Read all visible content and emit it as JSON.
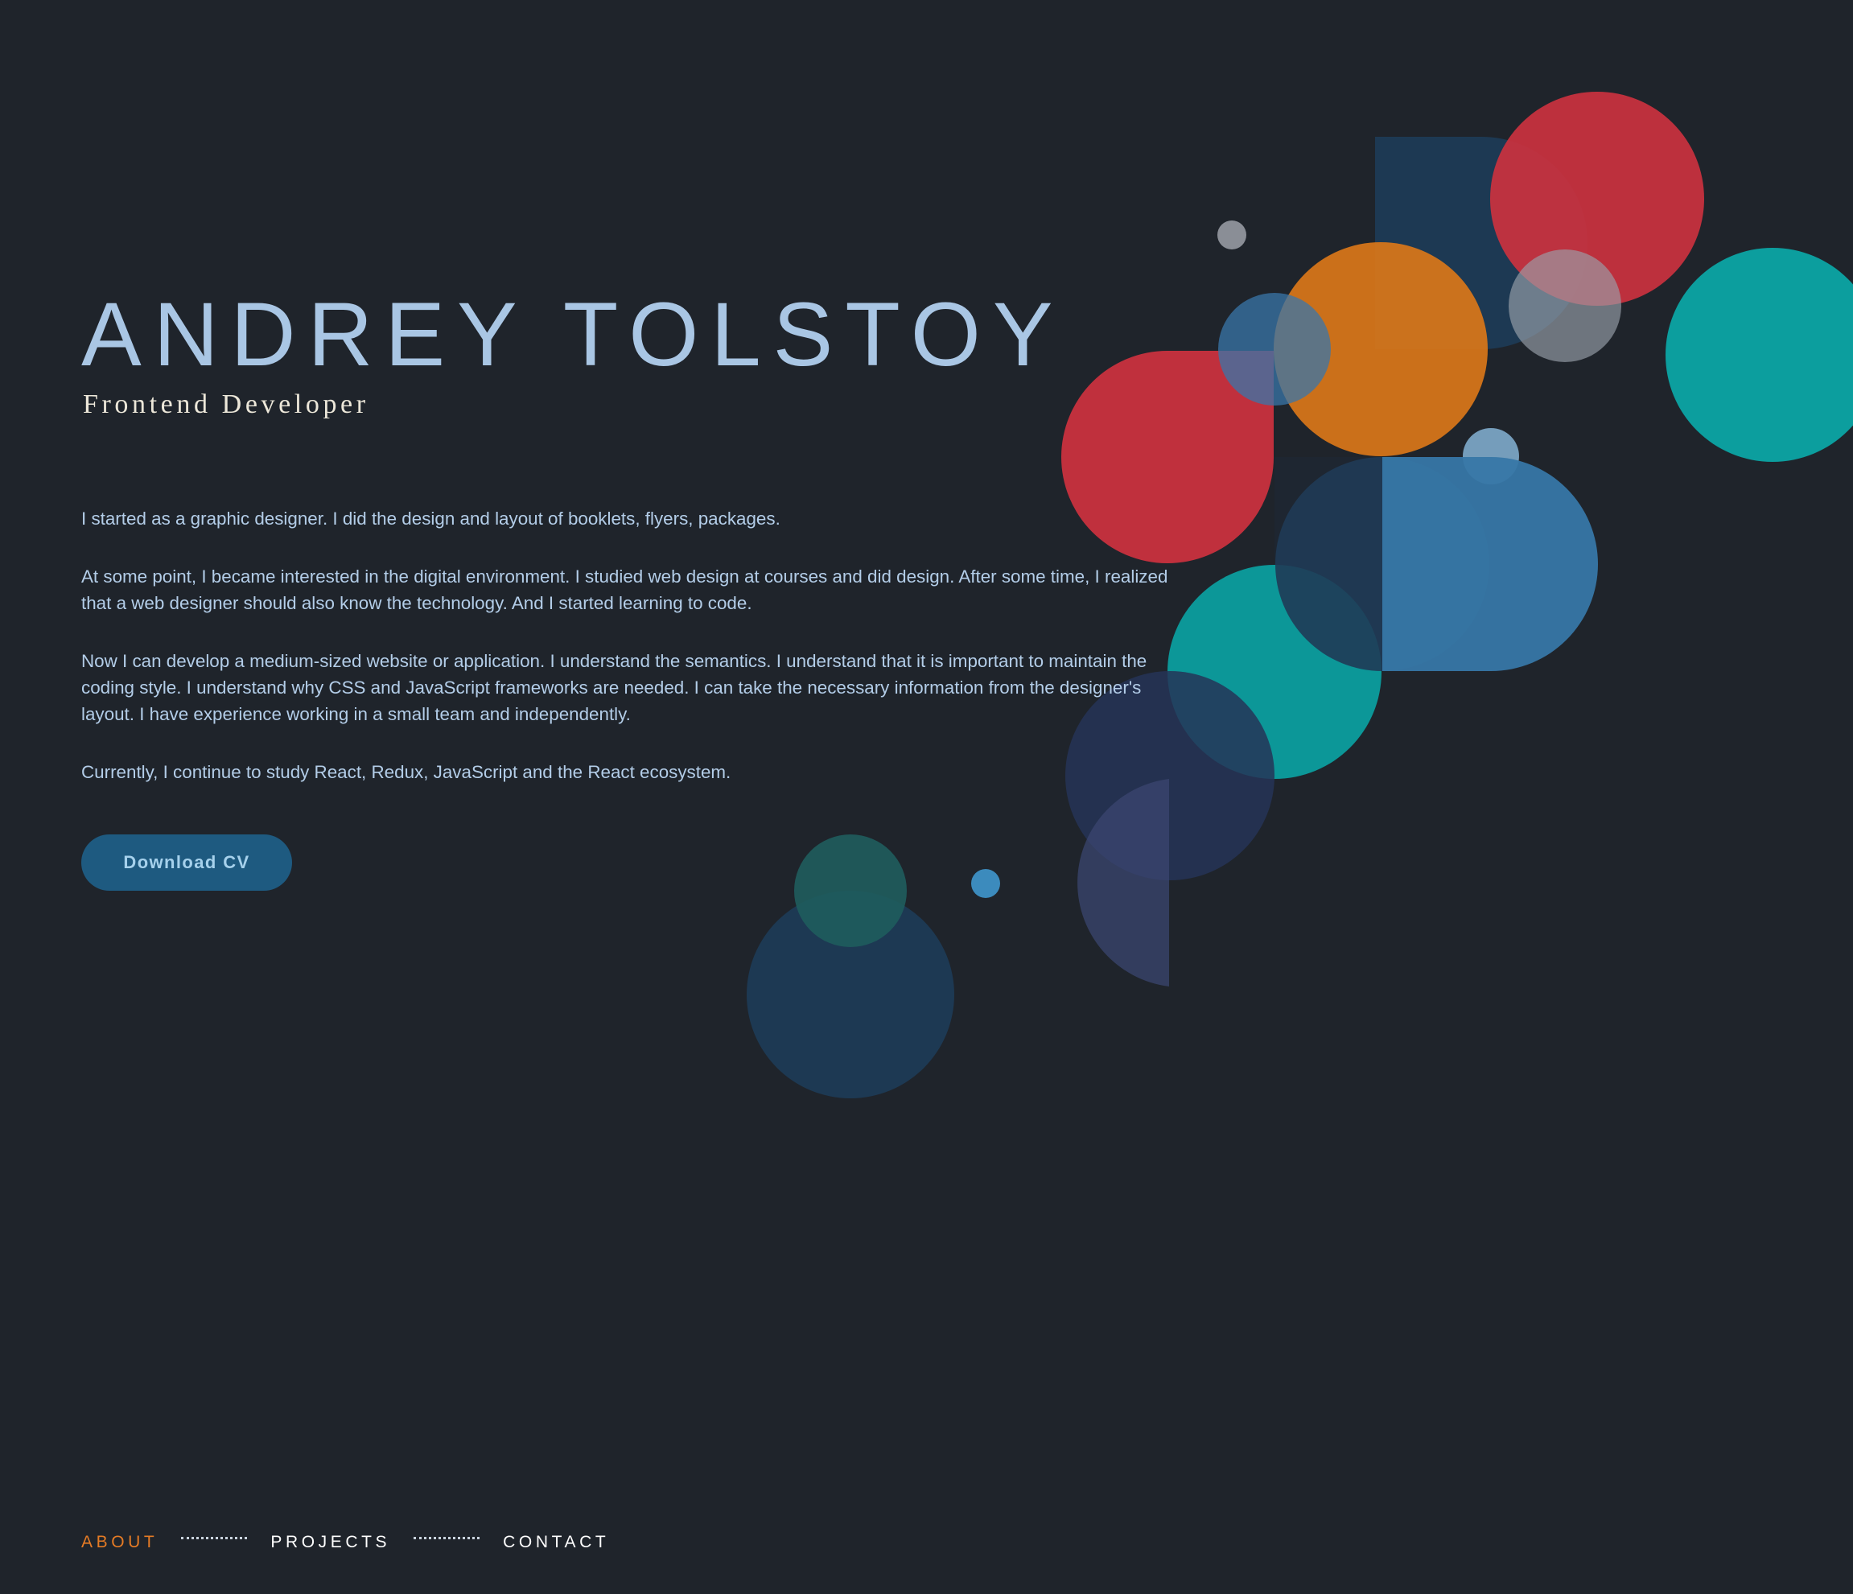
{
  "header": {
    "name": "ANDREY TOLSTOY",
    "role": "Frontend Developer"
  },
  "bio": {
    "paragraphs": [
      "I started as a graphic designer. I did the design and layout of booklets, flyers, packages.",
      "At some point, I became interested in the digital environment. I studied web design at courses and did design. After some time, I realized that a web designer should also know the technology. And I started learning to code.",
      "Now I can develop a medium-sized website or application. I understand the semantics. I understand that it is important to maintain the coding style. I understand why CSS and JavaScript frameworks are needed. I can take the necessary information from the designer's layout. I have experience working in a small team and independently.",
      "Currently, I continue to study React, Redux, JavaScript and the React ecosystem."
    ]
  },
  "cv_button": {
    "label": "Download CV"
  },
  "nav": {
    "items": [
      {
        "label": "ABOUT",
        "active": true
      },
      {
        "label": "PROJECTS",
        "active": false
      },
      {
        "label": "CONTACT",
        "active": false
      }
    ]
  },
  "colors": {
    "background": "#1f242b",
    "name_text": "#a9c6e4",
    "role_text": "#ece7d9",
    "body_text": "#b3cde8",
    "accent_active": "#e57b25",
    "button_bg": "#1e5a80",
    "button_text": "#a6d1ec",
    "shape_red": "#c9323e",
    "shape_orange": "#d87619",
    "shape_teal": "#0c9e9e",
    "shape_blue": "#3777a6",
    "shape_navy": "#263457",
    "shape_deep_blue": "#1e3b55",
    "shape_gray": "#8a8e96"
  }
}
